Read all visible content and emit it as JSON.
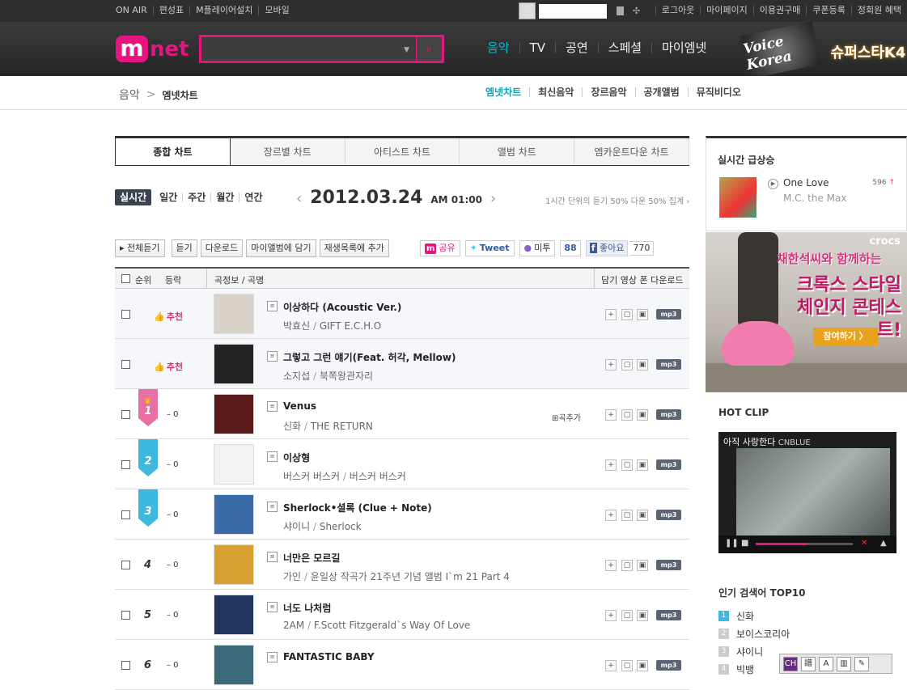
{
  "topbar": {
    "left": [
      "ON AIR",
      "편성표",
      "M플레이어설치",
      "모바일"
    ],
    "right": [
      "로그아웃",
      "마이페이지",
      "이용권구매",
      "쿠폰등록",
      "정회원 혜택"
    ]
  },
  "header": {
    "logo_m": "m",
    "logo_net": "net",
    "gnb": [
      "음악",
      "TV",
      "공연",
      "스페셜",
      "마이엠넷"
    ],
    "promo1": "Voice Korea",
    "promo2": "슈퍼스타K4"
  },
  "subnav": {
    "crumb_root": "음악",
    "crumb_sep": ">",
    "crumb_current": "엠넷차트",
    "menu": [
      "엠넷차트",
      "최신음악",
      "장르음악",
      "공개앨범",
      "뮤직비디오"
    ]
  },
  "tabs": [
    "종합 차트",
    "장르별 차트",
    "아티스트 차트",
    "앨범 차트",
    "엠카운트다운 차트"
  ],
  "period": [
    "실시간",
    "일간",
    "주간",
    "월간",
    "연간"
  ],
  "date": {
    "prev": "‹",
    "date": "2012.03.24",
    "time": "AM 01:00",
    "next": "›"
  },
  "note": "1시간 단위의 듣기 50% 다운 50% 집계 ›",
  "buttons": [
    "▸ 전체듣기",
    "듣기",
    "다운로드",
    "마이앨범에 담기",
    "재생목록에 추가"
  ],
  "social": {
    "m_label": "공유",
    "tweet": "Tweet",
    "metoo": "미투",
    "metoo_count": "88",
    "like": "좋아요",
    "like_count": "770"
  },
  "table_head": {
    "rank": "순위",
    "change": "등락",
    "song": "곡정보 / 곡명",
    "actions": "담기 영상 폰 다운로드"
  },
  "rows": [
    {
      "rank": "",
      "badge": "추천",
      "change": "",
      "title": "이상하다 (Acoustic Ver.)",
      "artist": "박효신",
      "album": "GIFT E.C.H.O",
      "thumb": "#d8d2c8"
    },
    {
      "rank": "",
      "badge": "추천",
      "change": "",
      "title": "그렇고 그런 얘기(Feat. 허각, Mellow)",
      "artist": "소지섭",
      "album": "북쪽왕관자리",
      "thumb": "#222"
    },
    {
      "rank": "1",
      "badge": "",
      "change": "– 0",
      "title": "Venus",
      "artist": "신화",
      "album": "THE RETURN",
      "thumb": "#5a1a1a",
      "add": "곡추가"
    },
    {
      "rank": "2",
      "badge": "",
      "change": "– 0",
      "title": "이상형",
      "artist": "버스커 버스커",
      "album": "버스커 버스커",
      "thumb": "#f2f2f2"
    },
    {
      "rank": "3",
      "badge": "",
      "change": "– 0",
      "title": "Sherlock•셜록 (Clue + Note)",
      "artist": "샤이니",
      "album": "Sherlock",
      "thumb": "#3b6aa8"
    },
    {
      "rank": "4",
      "badge": "",
      "change": "– 0",
      "title": "너만은 모르길",
      "artist": "가인",
      "album": "윤일상 작곡가 21주년 기념 앨범 I`m 21 Part 4",
      "thumb": "#d8a030"
    },
    {
      "rank": "5",
      "badge": "",
      "change": "– 0",
      "title": "너도 나처럼",
      "artist": "2AM",
      "album": "F.Scott Fitzgerald`s Way Of Love",
      "thumb": "#1f3560"
    },
    {
      "rank": "6",
      "badge": "",
      "change": "– 0",
      "title": "FANTASTIC BABY",
      "artist": "",
      "album": "",
      "thumb": "#3a6a7a"
    }
  ],
  "row_icons": {
    "plus": "+",
    "video": "▢",
    "phone": "▣",
    "mp3": "mp3"
  },
  "rise": {
    "title": "실시간 급상승",
    "song": "One Love",
    "artist": "M.C. the Max",
    "count": "596",
    "arrow": "↑"
  },
  "ad": {
    "brand": "crocs",
    "line1": "채한석씨와 함께하는",
    "line2": "크록스 스타일",
    "line3": "체인지 콘테스트!",
    "cta": "참여하기 〉"
  },
  "hotclip": {
    "title": "HOT CLIP",
    "song": "아직 사랑한다",
    "artist": "CNBLUE"
  },
  "top10": {
    "title": "인기 검색어 TOP10",
    "items": [
      {
        "n": "1",
        "k": "신화"
      },
      {
        "n": "2",
        "k": "보이스코리아"
      },
      {
        "n": "3",
        "k": "샤이니"
      },
      {
        "n": "4",
        "k": "빅뱅"
      }
    ]
  },
  "ime": [
    "CH",
    "譜",
    "A",
    "▥",
    "✎"
  ]
}
